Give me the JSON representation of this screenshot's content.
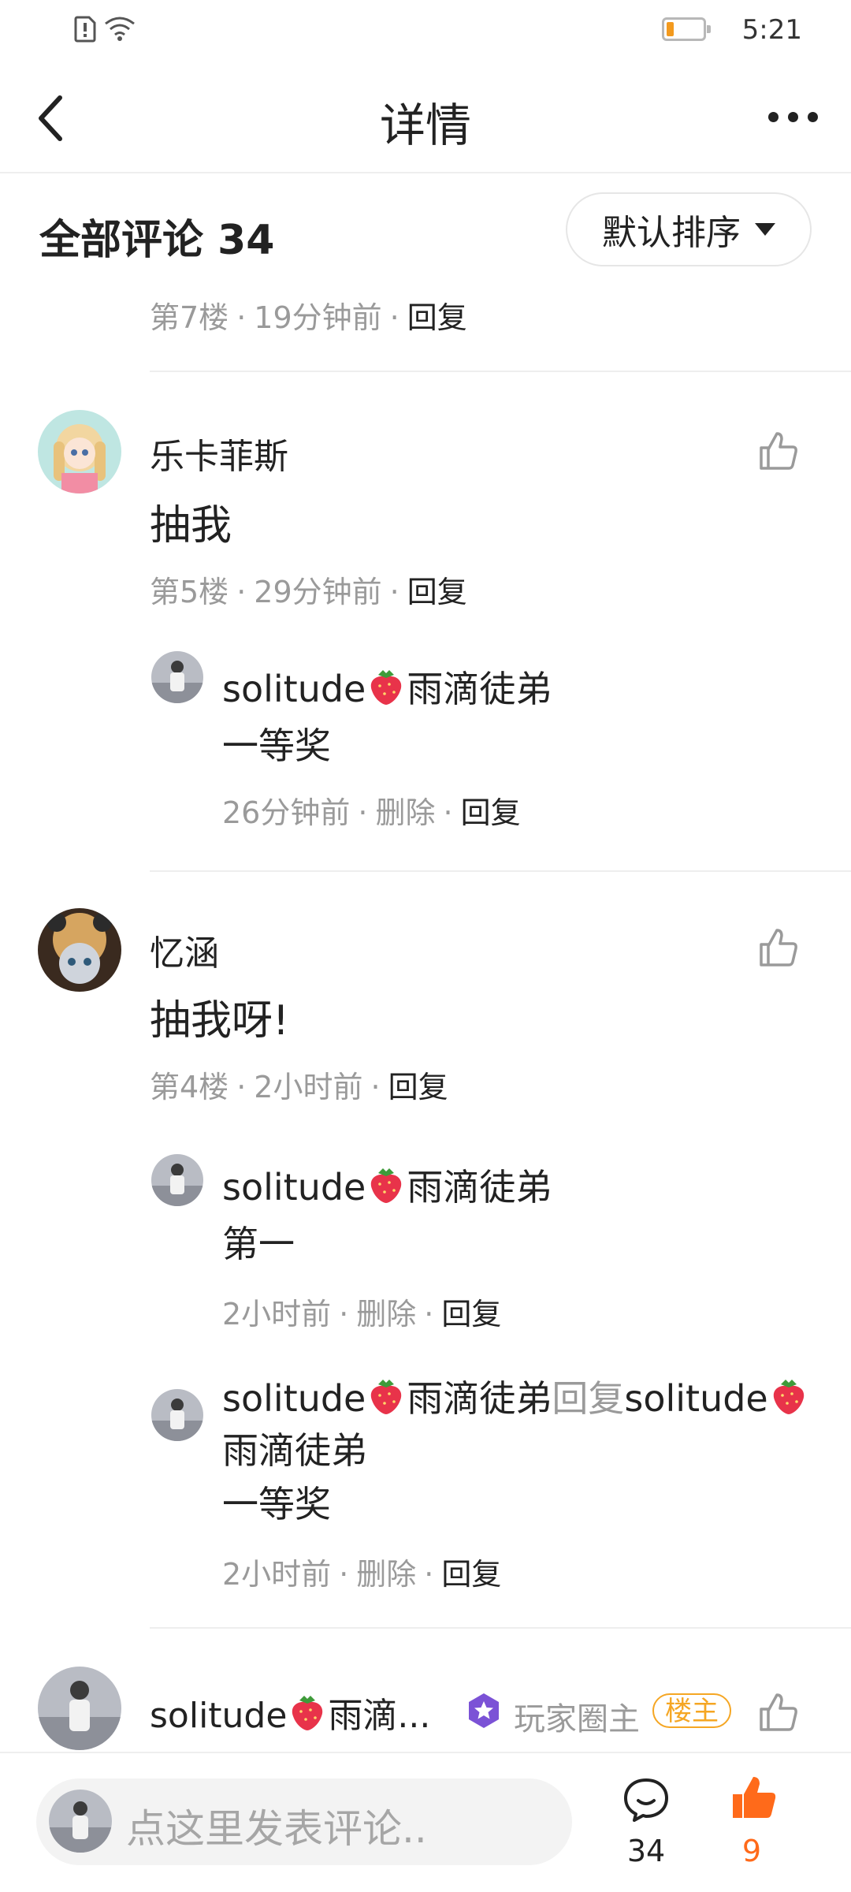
{
  "status_bar": {
    "time": "5:21",
    "battery_color": "#f39a1e"
  },
  "nav": {
    "title": "详情"
  },
  "comments_header": {
    "title": "全部评论 34",
    "sort_label": "默认排序"
  },
  "comments": [
    {
      "meta": {
        "floor": "第7楼",
        "time": "19分钟前",
        "reply": "回复"
      }
    },
    {
      "username": "乐卡菲斯",
      "text": "抽我",
      "meta": {
        "floor": "第5楼",
        "time": "29分钟前",
        "reply": "回复"
      },
      "replies": [
        {
          "username": "solitude",
          "username_suffix": "雨滴徒弟",
          "text": "一等奖",
          "meta": {
            "time": "26分钟前",
            "delete": "删除",
            "reply": "回复"
          }
        }
      ]
    },
    {
      "username": "忆涵",
      "text": "抽我呀!",
      "meta": {
        "floor": "第4楼",
        "time": "2小时前",
        "reply": "回复"
      },
      "replies": [
        {
          "username": "solitude",
          "username_suffix": "雨滴徒弟",
          "text": "第一",
          "meta": {
            "time": "2小时前",
            "delete": "删除",
            "reply": "回复"
          }
        },
        {
          "username": "solitude",
          "username_suffix": "雨滴徒弟",
          "reply_to_label": "回复",
          "reply_to_username": "solitude",
          "reply_to_suffix": "雨滴徒弟",
          "text": "一等奖",
          "meta": {
            "time": "2小时前",
            "delete": "删除",
            "reply": "回复"
          }
        }
      ]
    },
    {
      "username": "solitude",
      "username_suffix": "雨滴...",
      "role_label": "玩家圈主",
      "owner_badge": "楼主"
    }
  ],
  "bottom_bar": {
    "placeholder": "点这里发表评论..",
    "comment_count": "34",
    "like_count": "9",
    "like_color": "#ff6a1a"
  }
}
